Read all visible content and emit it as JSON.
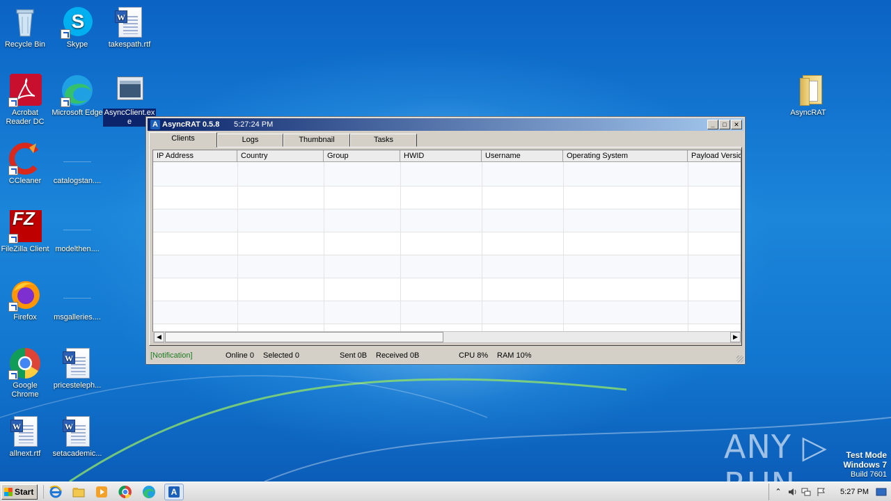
{
  "desktop_icons": [
    {
      "name": "recycle-bin",
      "label": "Recycle Bin"
    },
    {
      "name": "skype",
      "label": "Skype"
    },
    {
      "name": "takespath",
      "label": "takespath.rtf"
    },
    {
      "name": "acrobat",
      "label": "Acrobat Reader DC"
    },
    {
      "name": "edge",
      "label": "Microsoft Edge"
    },
    {
      "name": "asyncclient",
      "label": "AsyncClient.exe"
    },
    {
      "name": "asyncrat-folder",
      "label": "AsyncRAT"
    },
    {
      "name": "ccleaner",
      "label": "CCleaner"
    },
    {
      "name": "catalogstan",
      "label": "catalogstan...."
    },
    {
      "name": "filezilla",
      "label": "FileZilla Client"
    },
    {
      "name": "modelthen",
      "label": "modelthen...."
    },
    {
      "name": "firefox",
      "label": "Firefox"
    },
    {
      "name": "msgalleries",
      "label": "msgalleries...."
    },
    {
      "name": "chrome",
      "label": "Google Chrome"
    },
    {
      "name": "pricesteleph",
      "label": "pricesteleph..."
    },
    {
      "name": "allnext",
      "label": "allnext.rtf"
    },
    {
      "name": "setacademic",
      "label": "setacademic..."
    }
  ],
  "window": {
    "app_name": "AsyncRAT 0.5.8",
    "time": "5:27:24 PM",
    "tabs": [
      "Clients",
      "Logs",
      "Thumbnail",
      "Tasks"
    ],
    "columns": [
      "IP Address",
      "Country",
      "Group",
      "HWID",
      "Username",
      "Operating System",
      "Payload Versio"
    ],
    "status": {
      "notification": "[Notification]",
      "online": "Online 0",
      "selected": "Selected 0",
      "sent": "Sent 0B",
      "received": "Received 0B",
      "cpu": "CPU 8%",
      "ram": "RAM 10%"
    }
  },
  "watermark": {
    "brand": "ANY ▷ RUN",
    "line1": "Test Mode",
    "line2": "Windows 7",
    "line3": "Build 7601"
  },
  "taskbar": {
    "start_label": "Start",
    "clock": "5:27 PM"
  },
  "colors": {
    "notification_green": "#1f7a1f",
    "title_start": "#0a246a",
    "title_end": "#a6caf0"
  }
}
